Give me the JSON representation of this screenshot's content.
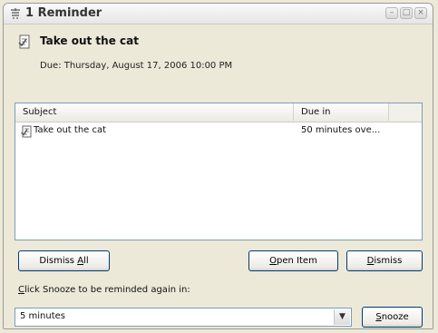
{
  "window": {
    "title": "1 Reminder",
    "buttons": {
      "minimize": "–",
      "maximize": "□",
      "close": "×"
    }
  },
  "reminder": {
    "subject": "Take out the cat",
    "due_text": "Due: Thursday, August 17, 2006 10:00 PM"
  },
  "list": {
    "headers": {
      "subject": "Subject",
      "due_in": "Due in"
    },
    "rows": [
      {
        "subject": "Take out the cat",
        "due_in": "50 minutes ove..."
      }
    ]
  },
  "buttons": {
    "dismiss_all": {
      "pre": "Dismiss ",
      "accel": "A",
      "post": "ll"
    },
    "open_item": {
      "pre": "",
      "accel": "O",
      "post": "pen Item"
    },
    "dismiss": {
      "pre": "",
      "accel": "D",
      "post": "ismiss"
    },
    "snooze": {
      "pre": "",
      "accel": "S",
      "post": "nooze"
    }
  },
  "snooze": {
    "label_accel": "C",
    "label_rest": "lick Snooze to be reminded again in:",
    "selected": "5 minutes"
  },
  "icons": {
    "title": "reminder-bell-icon",
    "header": "task-item-icon",
    "row": "task-item-icon",
    "dropdown": "chevron-down-icon"
  }
}
